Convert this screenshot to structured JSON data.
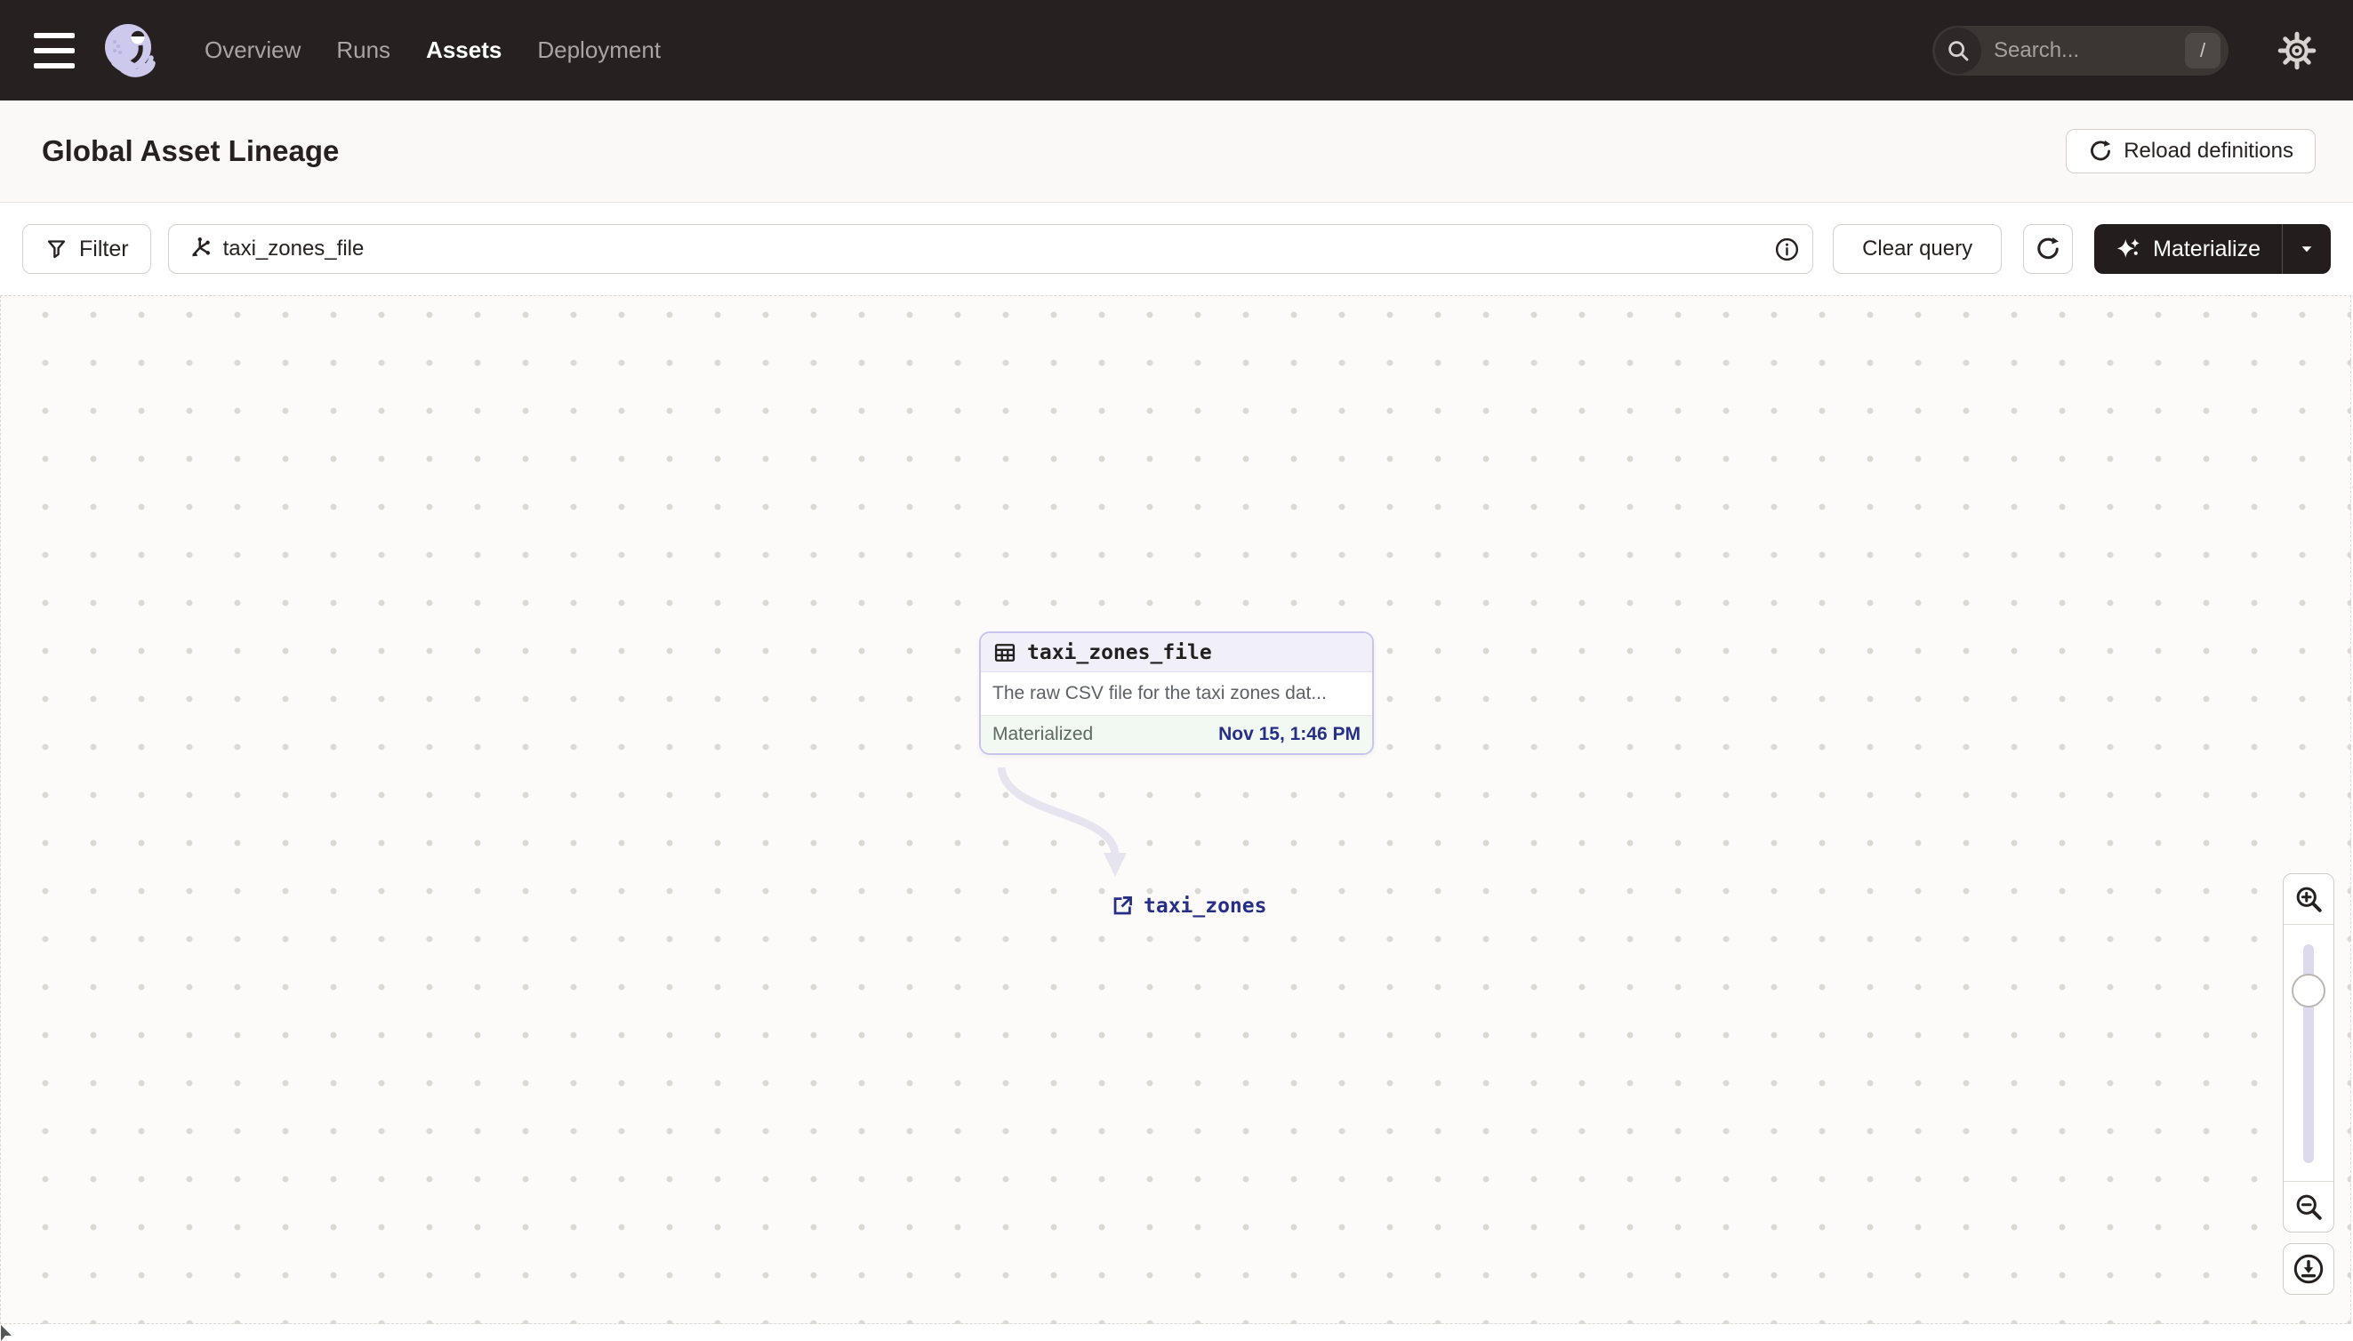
{
  "nav": {
    "links": [
      "Overview",
      "Runs",
      "Assets",
      "Deployment"
    ],
    "active_link": "Assets",
    "search_placeholder": "Search...",
    "search_shortcut": "/"
  },
  "header": {
    "title": "Global Asset Lineage",
    "reload_label": "Reload definitions"
  },
  "toolbar": {
    "filter_label": "Filter",
    "query_value": "taxi_zones_file",
    "clear_label": "Clear query",
    "materialize_label": "Materialize"
  },
  "graph": {
    "node": {
      "title": "taxi_zones_file",
      "description": "The raw CSV file for the taxi zones dat...",
      "status_label": "Materialized",
      "materialized_at": "Nov 15, 1:46 PM"
    },
    "downstream_label": "taxi_zones"
  },
  "colors": {
    "nav_bg": "#262120",
    "node_border_lavender": "#c8c4ee",
    "link_navy": "#272e86",
    "materialized_footer_bg": "#f2f8f2",
    "canvas_bg": "#fcfbfa"
  }
}
